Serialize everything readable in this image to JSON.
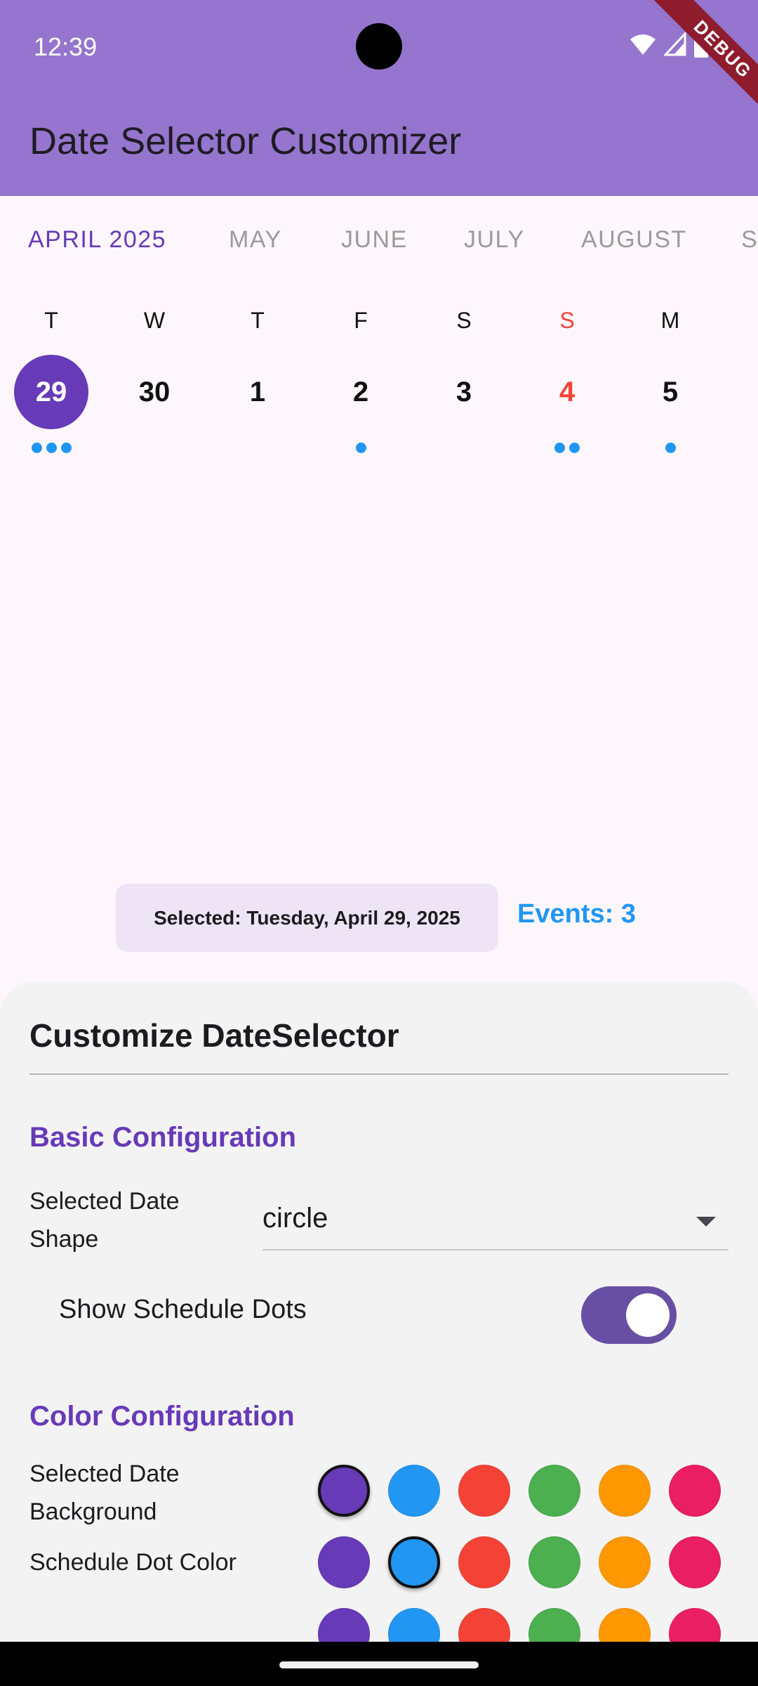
{
  "status_bar": {
    "time": "12:39"
  },
  "debug_label": "DEBUG",
  "app_bar": {
    "title": "Date Selector Customizer"
  },
  "months": [
    "APRIL 2025",
    "MAY",
    "JUNE",
    "JULY",
    "AUGUST",
    "S"
  ],
  "active_month": "APRIL 2025",
  "days": [
    {
      "dow": "T",
      "num": "29",
      "dots": 3,
      "selected": true,
      "sunday": false
    },
    {
      "dow": "W",
      "num": "30",
      "dots": 0,
      "selected": false,
      "sunday": false
    },
    {
      "dow": "T",
      "num": "1",
      "dots": 0,
      "selected": false,
      "sunday": false
    },
    {
      "dow": "F",
      "num": "2",
      "dots": 1,
      "selected": false,
      "sunday": false
    },
    {
      "dow": "S",
      "num": "3",
      "dots": 0,
      "selected": false,
      "sunday": false
    },
    {
      "dow": "S",
      "num": "4",
      "dots": 2,
      "selected": false,
      "sunday": true
    },
    {
      "dow": "M",
      "num": "5",
      "dots": 1,
      "selected": false,
      "sunday": false
    }
  ],
  "selected_info": "Selected: Tuesday, April 29, 2025",
  "events_label": "Events: 3",
  "sheet": {
    "title": "Customize DateSelector",
    "basic_section": "Basic Configuration",
    "shape_label_1": "Selected Date",
    "shape_label_2": "Shape",
    "shape_value": "circle",
    "schedule_dots_label": "Show Schedule Dots",
    "schedule_dots_on": true,
    "color_section": "Color Configuration",
    "bg_label_1": "Selected Date",
    "bg_label_2": "Background",
    "dot_color_label": "Schedule Dot Color"
  },
  "colors": {
    "palette": [
      "#673ab7",
      "#2196f3",
      "#f44336",
      "#4caf50",
      "#ff9800",
      "#e91e63"
    ],
    "selected_bg_index": 0,
    "dot_color_index": 1,
    "accent": "#673ab7",
    "app_bar": "#9575cd",
    "dot": "#2196f3",
    "weekend": "#f44336"
  }
}
